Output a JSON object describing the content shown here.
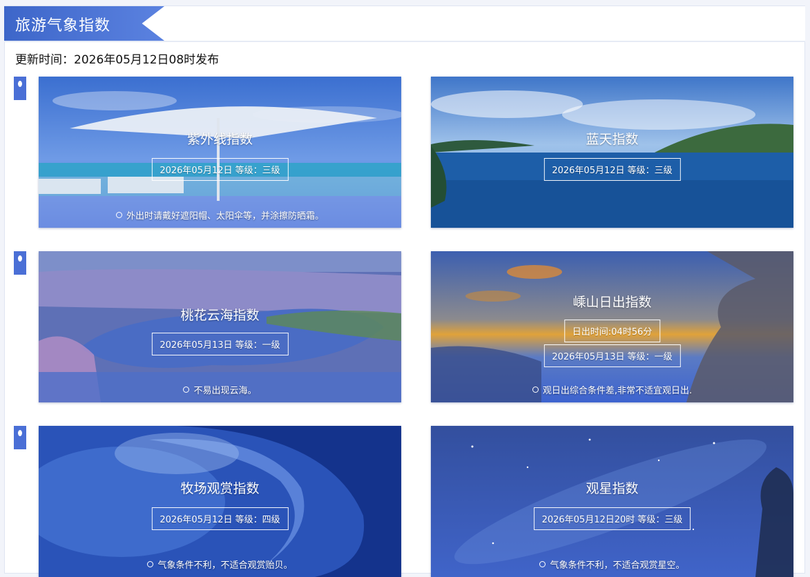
{
  "header": {
    "title": "旅游气象指数"
  },
  "update_time": "更新时间：2026年05月12日08时发布",
  "cards": [
    {
      "title": "紫外线指数",
      "box": "2026年05月12日 等级：三级",
      "tip": "外出时请戴好遮阳帽、太阳伞等，并涂擦防晒霜。"
    },
    {
      "title": "蓝天指数",
      "box": "2026年05月12日 等级：三级",
      "tip": ""
    },
    {
      "title": "桃花云海指数",
      "box": "2026年05月13日 等级：一级",
      "tip": "不易出现云海。"
    },
    {
      "title": "嵊山日出指数",
      "box_top": "日出时间:04时56分",
      "box": "2026年05月13日 等级：一级",
      "tip": "观日出综合条件差,非常不适宜观日出."
    },
    {
      "title": "牧场观赏指数",
      "box": "2026年05月12日 等级：四级",
      "tip": "气象条件不利，不适合观赏贻贝。"
    },
    {
      "title": "观星指数",
      "box": "2026年05月12日20时 等级：三级",
      "tip": "气象条件不利，不适合观赏星空。"
    }
  ],
  "colors": {
    "accent": "#4a6fd6",
    "header_tab": "#3d66c9"
  }
}
